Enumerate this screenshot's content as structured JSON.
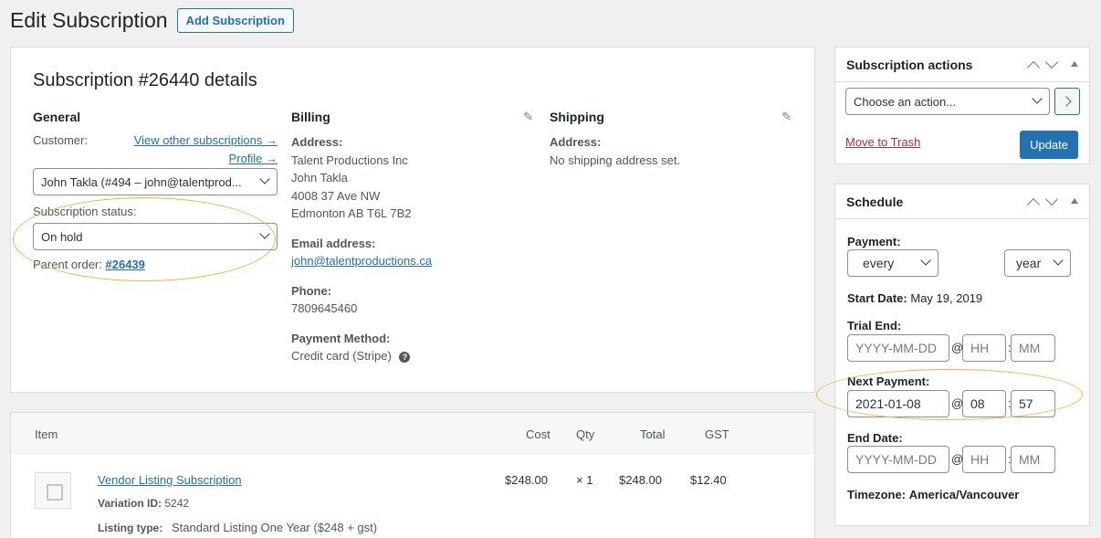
{
  "header": {
    "title": "Edit Subscription",
    "add_label": "Add Subscription"
  },
  "details": {
    "title": "Subscription #26440 details",
    "general": {
      "heading": "General",
      "customer_label": "Customer:",
      "view_other_link": "View other subscriptions →",
      "profile_link": "Profile →",
      "customer_value": "John Takla (#494 – john@talentprod...",
      "status_label": "Subscription status:",
      "status_value": "On hold",
      "parent_label": "Parent order:",
      "parent_link": "#26439"
    },
    "billing": {
      "heading": "Billing",
      "address_label": "Address:",
      "address_lines": [
        "Talent Productions Inc",
        "John Takla",
        "4008 37 Ave NW",
        "Edmonton AB T6L 7B2"
      ],
      "email_label": "Email address:",
      "email": "john@talentproductions.ca",
      "phone_label": "Phone:",
      "phone": "7809645460",
      "payment_label": "Payment Method:",
      "payment": "Credit card (Stripe)"
    },
    "shipping": {
      "heading": "Shipping",
      "address_label": "Address:",
      "address_value": "No shipping address set."
    }
  },
  "items": {
    "headers": {
      "item": "Item",
      "cost": "Cost",
      "qty": "Qty",
      "total": "Total",
      "gst": "GST"
    },
    "row": {
      "name": "Vendor Listing Subscription",
      "variation_label": "Variation ID:",
      "variation_id": "5242",
      "listing_label": "Listing type:",
      "listing_value": "Standard Listing One Year ($248 + gst)",
      "cost": "$248.00",
      "qty": "× 1",
      "total": "$248.00",
      "gst": "$12.40"
    }
  },
  "actions": {
    "title": "Subscription actions",
    "select_value": "Choose an action...",
    "trash_label": "Move to Trash",
    "update_label": "Update"
  },
  "schedule": {
    "title": "Schedule",
    "payment_label": "Payment:",
    "interval": "every",
    "period": "year",
    "start_label": "Start Date:",
    "start_value": "May 19, 2019",
    "trial_label": "Trial End:",
    "date_placeholder": "YYYY-MM-DD",
    "hh_placeholder": "HH",
    "mm_placeholder": "MM",
    "next_label": "Next Payment:",
    "next_date": "2021-01-08",
    "next_hh": "08",
    "next_mm": "57",
    "end_label": "End Date:",
    "at": "@",
    "colon": ":",
    "timezone_label": "Timezone:",
    "timezone_value": "America/Vancouver"
  },
  "colors": {
    "accent": "#2271b1",
    "highlight": "#f0b449",
    "trash": "#b32d2e"
  }
}
